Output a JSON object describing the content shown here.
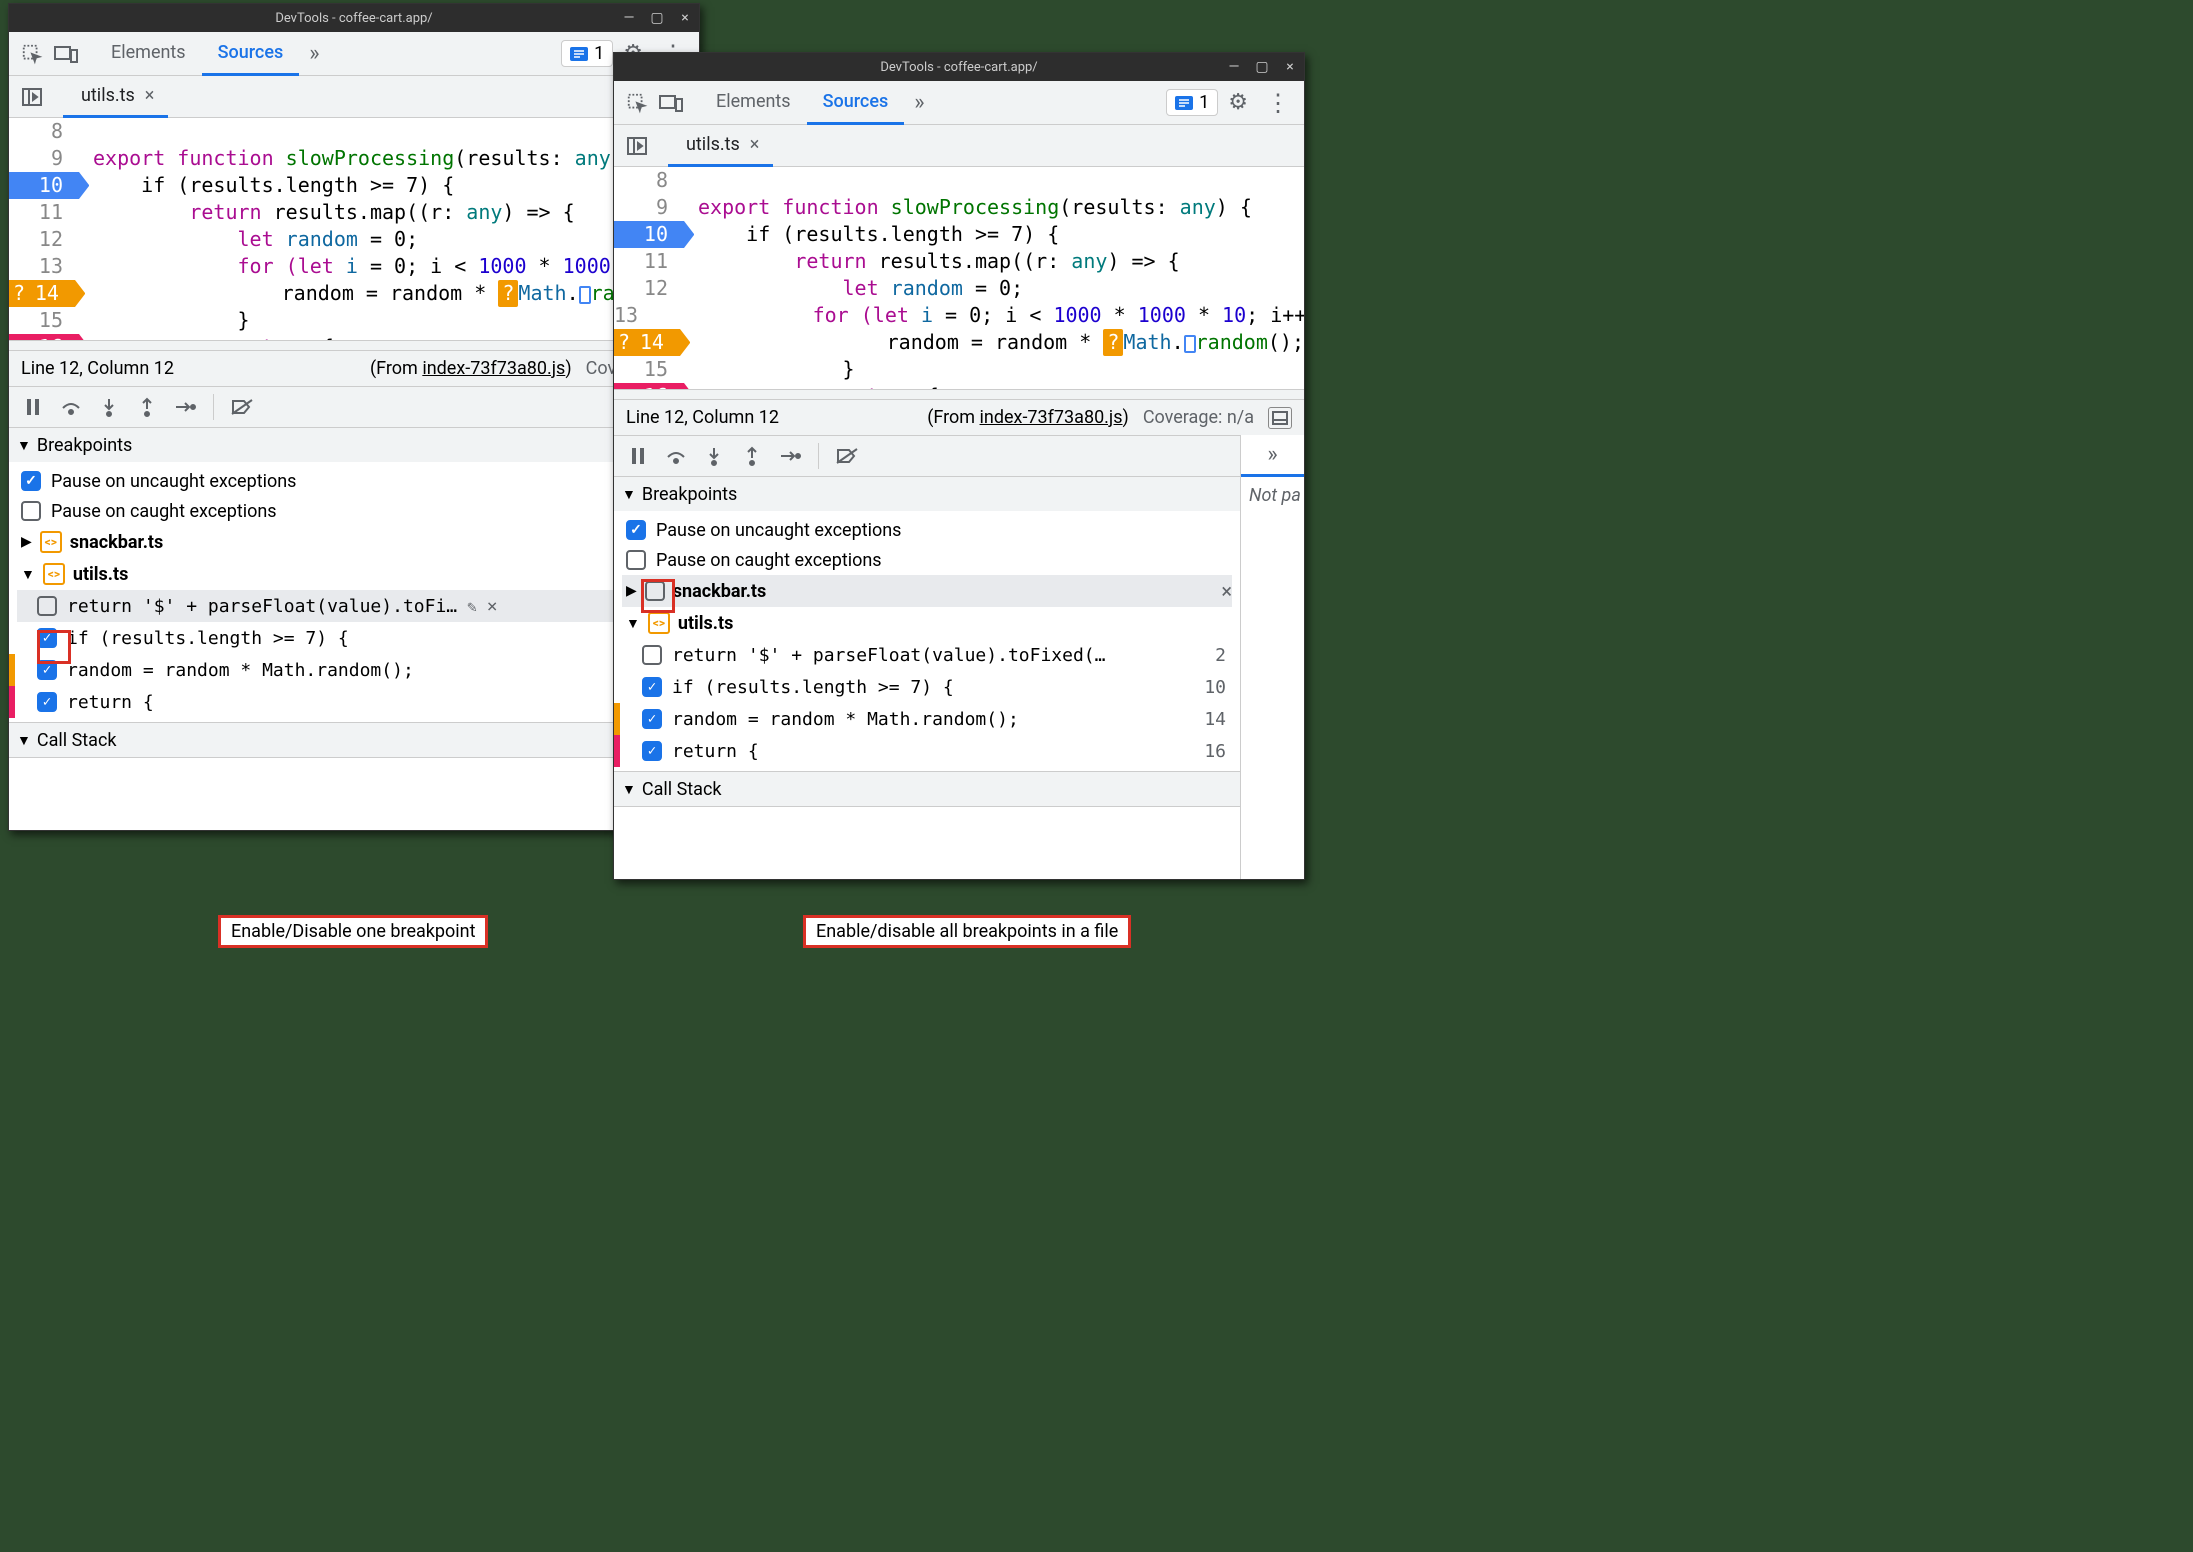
{
  "window_title": "DevTools - coffee-cart.app/",
  "tabs": {
    "elements": "Elements",
    "sources": "Sources"
  },
  "issue_count": "1",
  "file_tab": "utils.ts",
  "code_lines": {
    "8": "",
    "9_pre": "export ",
    "9_fn": "function ",
    "9_name": "slowProcessing",
    "9_rest": "(results: ",
    "9_ty": "any",
    "9_end": ")",
    "9b_end": " {",
    "10": "    if (results.length >= 7) {",
    "11_ret": "        return ",
    "11_rest": "results.map((r: ",
    "11_ty": "any",
    "11_end": ") => {",
    "12_pre": "            let ",
    "12_var": "random",
    "12_rest": " = 0;",
    "13_pre": "            for (",
    "13_let": "let ",
    "13_i": "i",
    "13_eq": " = 0; i < ",
    "13_n1": "1000",
    "13_m": " * ",
    "13_n2": "1000",
    "13_m2": " * ",
    "13_n3": "10",
    "13_end_short": ";",
    "13_end_long": "; i++) {",
    "14_pre": "                random = random * ",
    "14_math": "Math",
    "14_dot": ".",
    "14_rand": "random",
    "14_end": "();",
    "15": "            }",
    "16_pre": "            ",
    "16_ret": "return ",
    "16_end": "{"
  },
  "status": {
    "pos": "Line 12, Column 12",
    "from_label": "(From ",
    "from_file": "index-73f73a80.js",
    "from_end": ")",
    "coverage_left": "Coverage: n/",
    "coverage_right": "Coverage: n/a"
  },
  "breakpoints": {
    "header": "Breakpoints",
    "pause_uncaught": "Pause on uncaught exceptions",
    "pause_caught": "Pause on caught exceptions",
    "file1": "snackbar.ts",
    "file2": "utils.ts",
    "items": [
      {
        "text_short": "return '$' + parseFloat(value).toFi…",
        "text_long": "return '$' + parseFloat(value).toFixed(…",
        "ln": "2"
      },
      {
        "text": "if (results.length >= 7) {",
        "ln": "10"
      },
      {
        "text": "random = random * Math.random();",
        "ln": "14"
      },
      {
        "text": "return {",
        "ln": "16"
      }
    ]
  },
  "callstack": "Call Stack",
  "side_notpaused": "Not pa",
  "captions": {
    "left": "Enable/Disable one breakpoint",
    "right": "Enable/disable all breakpoints in a file"
  }
}
